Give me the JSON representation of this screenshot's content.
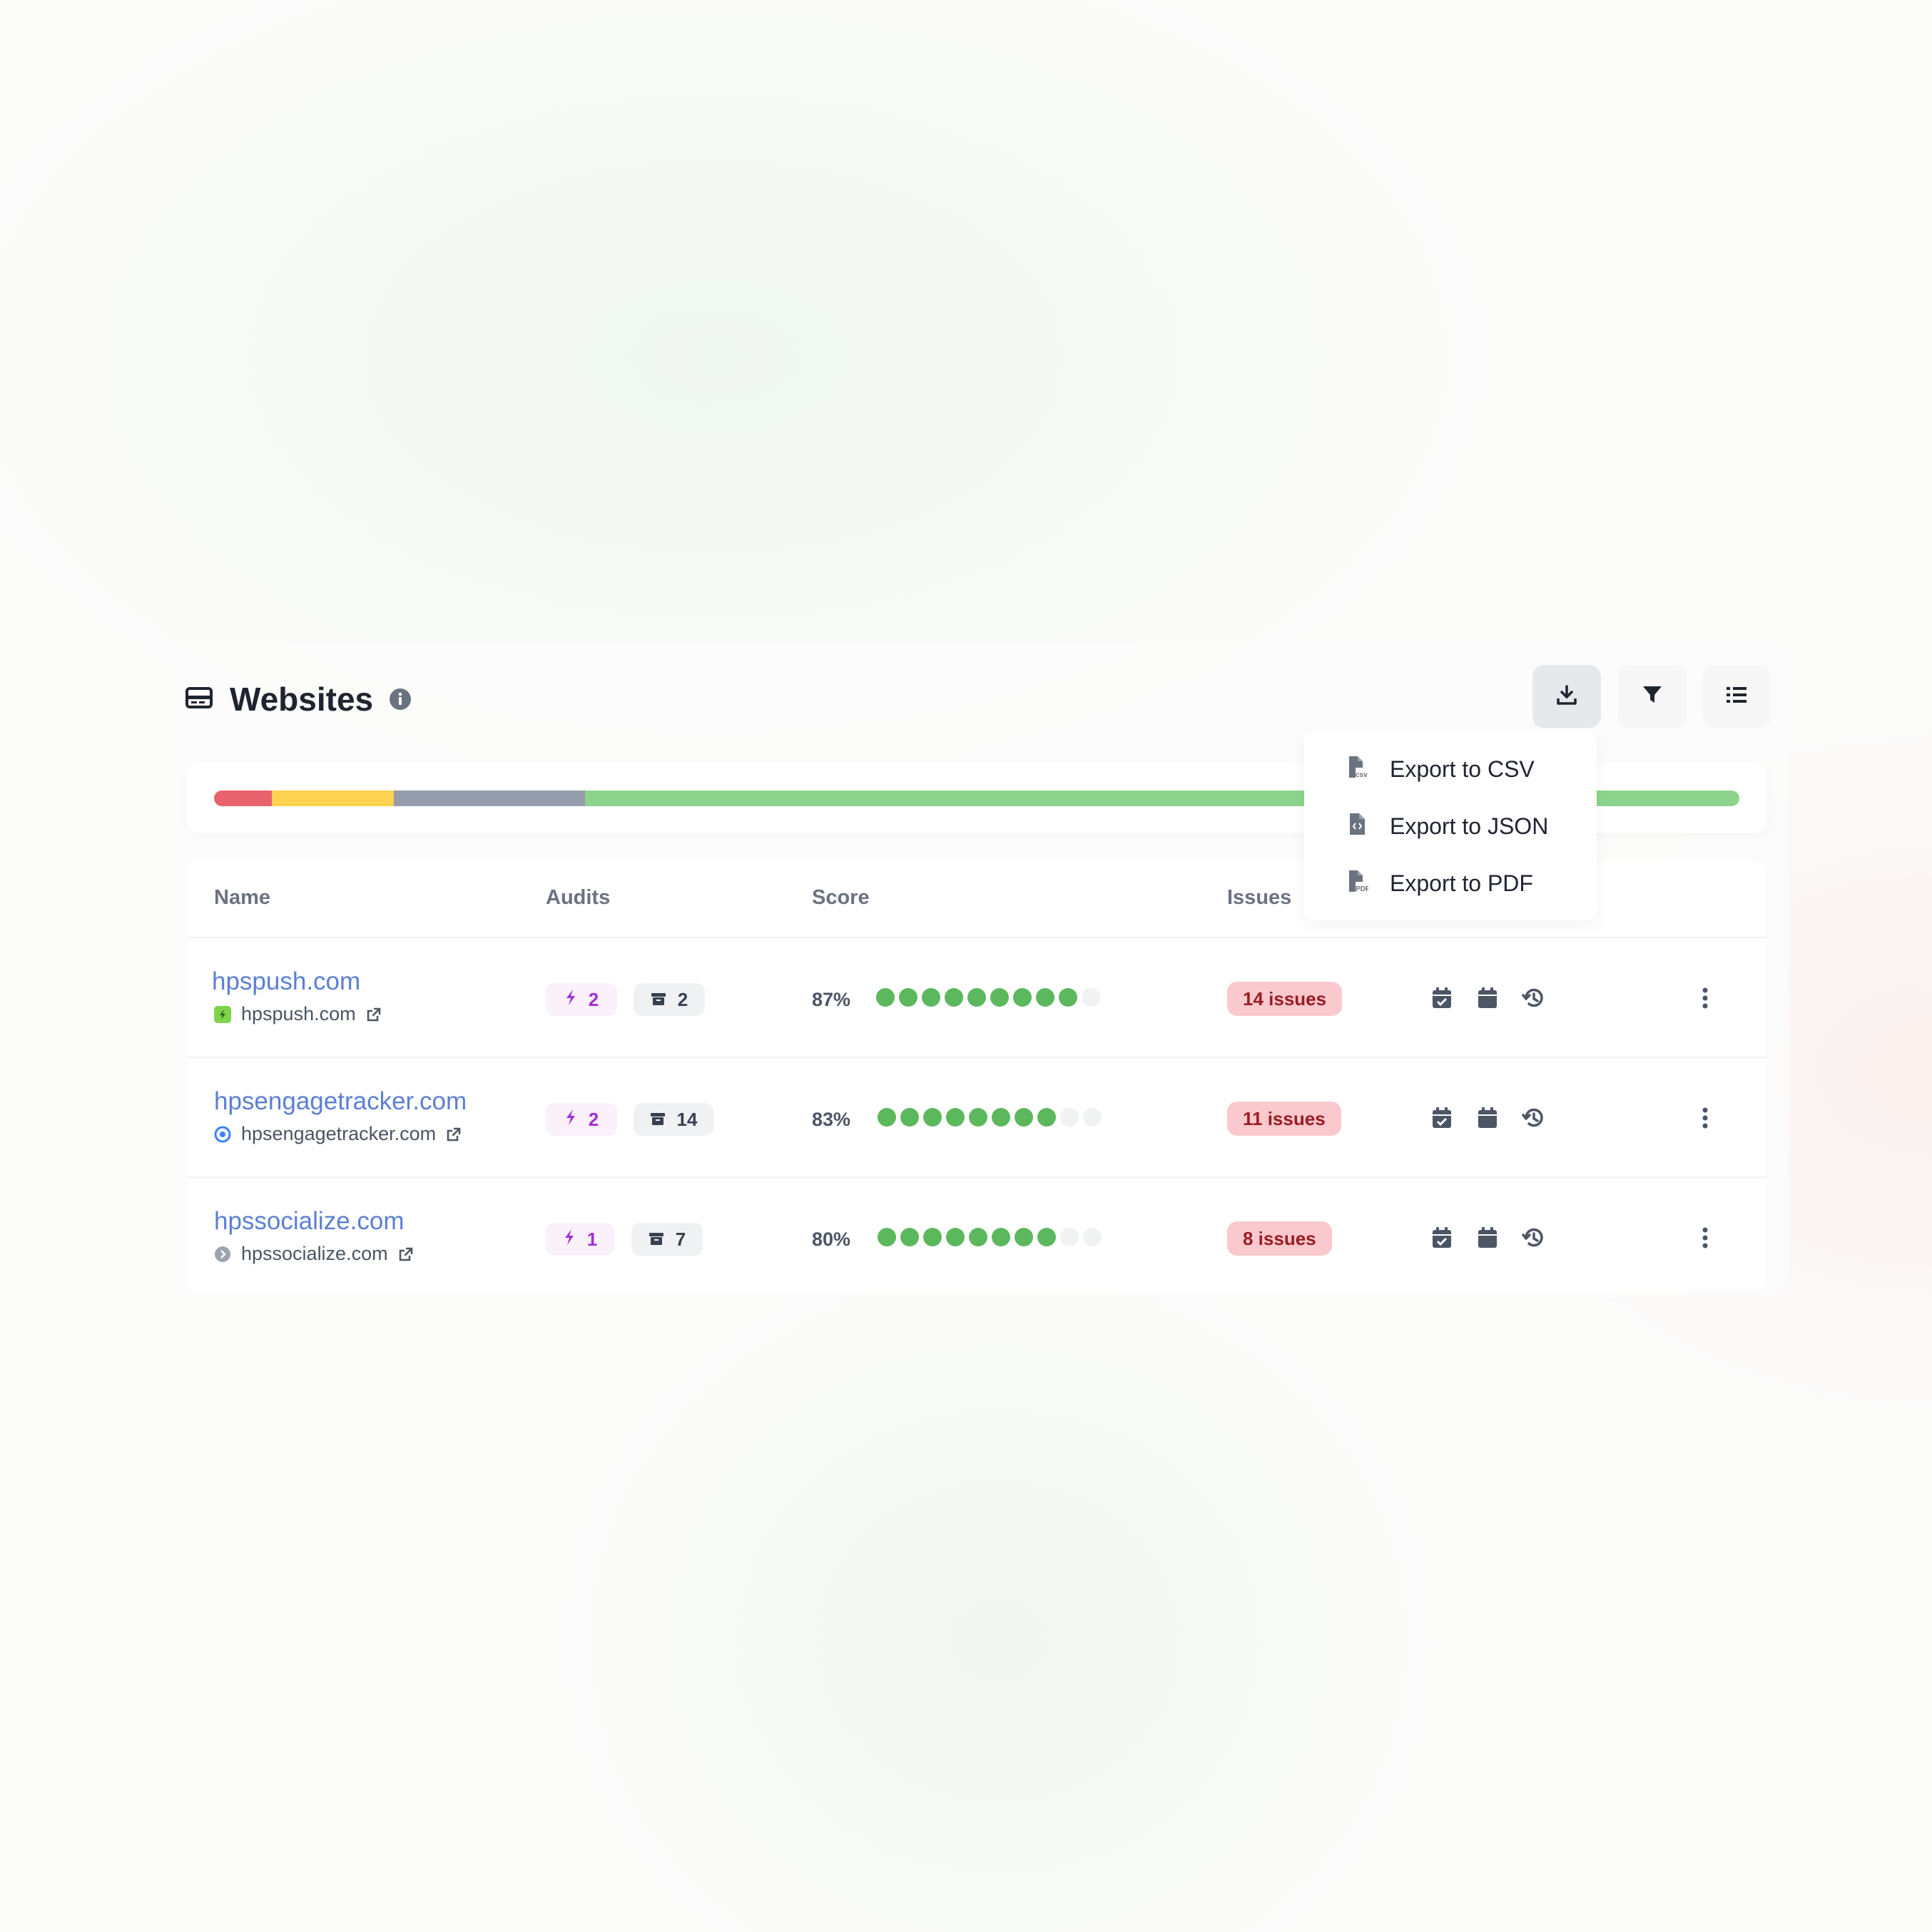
{
  "header": {
    "title": "Websites",
    "icons": {
      "title": "browser-card-icon",
      "info": "info-icon"
    },
    "toolbar": [
      {
        "icon": "download-icon",
        "active": true
      },
      {
        "icon": "filter-icon",
        "active": false
      },
      {
        "icon": "list-icon",
        "active": false
      }
    ]
  },
  "status_bar": {
    "segments": [
      {
        "status": "red",
        "color": "#e8636d",
        "fraction": 0.038
      },
      {
        "status": "yellow",
        "color": "#fcd250",
        "fraction": 0.08
      },
      {
        "status": "gray",
        "color": "#959cab",
        "fraction": 0.125
      },
      {
        "status": "green",
        "color": "#8cd48c",
        "fraction": 0.757
      }
    ]
  },
  "export_menu": {
    "items": [
      {
        "label": "Export to CSV",
        "icon": "file-csv-icon"
      },
      {
        "label": "Export to JSON",
        "icon": "file-code-icon"
      },
      {
        "label": "Export to PDF",
        "icon": "file-pdf-icon"
      }
    ]
  },
  "table": {
    "columns": {
      "name": "Name",
      "audits": "Audits",
      "score": "Score",
      "issues": "Issues"
    },
    "rows": [
      {
        "name": "hpspush.com",
        "domain": "hpspush.com",
        "favicon": "green-square-favicon",
        "audits_bolt": "2",
        "audits_archive": "2",
        "score_label": "87%",
        "score_dots_filled": 9,
        "score_dots_total": 10,
        "issues": "14 issues"
      },
      {
        "name": "hpsengagetracker.com",
        "domain": "hpsengagetracker.com",
        "favicon": "blue-circle-favicon",
        "audits_bolt": "2",
        "audits_archive": "14",
        "score_label": "83%",
        "score_dots_filled": 8,
        "score_dots_total": 10,
        "issues": "11 issues"
      },
      {
        "name": "hpssocialize.com",
        "domain": "hpssocialize.com",
        "favicon": "gray-circle-favicon",
        "audits_bolt": "1",
        "audits_archive": "7",
        "score_label": "80%",
        "score_dots_filled": 8,
        "score_dots_total": 10,
        "issues": "8 issues"
      }
    ],
    "row_actions": [
      "calendar-check-icon",
      "calendar-icon",
      "history-icon",
      "more-vertical-icon"
    ]
  },
  "colors": {
    "link": "#5b7fd6",
    "dot_on": "#5cb85c",
    "issue_bg": "#f9c9cd",
    "issue_text": "#9b1c24",
    "bolt": "#a02fd8"
  }
}
